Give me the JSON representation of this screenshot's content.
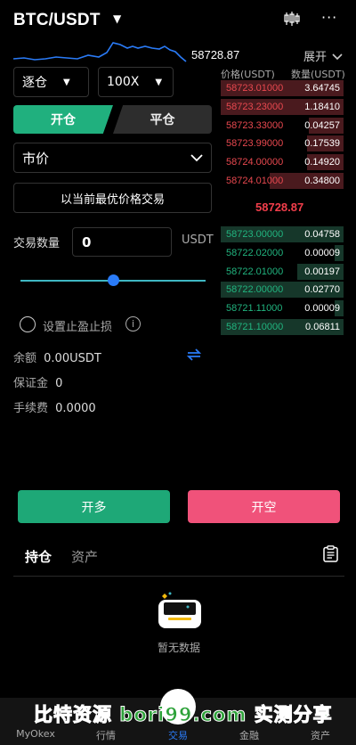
{
  "header": {
    "pair": "BTC/USDT",
    "pair_caret": "▼",
    "chart_icon": "candlestick-chart-icon",
    "more_icon": "more-dots-icon"
  },
  "mini_chart": {
    "price": "58728.87",
    "expand_label": "展开",
    "line_color": "#2a7bf7"
  },
  "margin_mode": {
    "value": "逐仓"
  },
  "leverage": {
    "value": "100X"
  },
  "side_tabs": {
    "open": "开仓",
    "close": "平仓"
  },
  "order_type": {
    "value": "市价"
  },
  "best_price_label": "以当前最优价格交易",
  "quantity": {
    "label": "交易数量",
    "value": "0",
    "unit": "USDT"
  },
  "slider": {
    "level": 0.5
  },
  "tpsl": {
    "label": "设置止盈止损"
  },
  "balance": {
    "label": "余额",
    "value": "0.00USDT"
  },
  "margin": {
    "label": "保证金",
    "value": "0"
  },
  "fee": {
    "label": "手续费",
    "value": "0.0000"
  },
  "buttons": {
    "long": "开多",
    "short": "开空"
  },
  "orderbook": {
    "price_header": "价格(USDT)",
    "qty_header": "数量(USDT)",
    "asks": [
      {
        "price": "58723.01000",
        "qty": "3.64745",
        "depth": 1.0
      },
      {
        "price": "58723.23000",
        "qty": "1.18410",
        "depth": 1.0
      },
      {
        "price": "58723.33000",
        "qty": "0.04257",
        "depth": 0.28
      },
      {
        "price": "58723.99000",
        "qty": "0.17539",
        "depth": 0.3
      },
      {
        "price": "58724.00000",
        "qty": "0.14920",
        "depth": 0.3
      },
      {
        "price": "58724.01000",
        "qty": "0.34800",
        "depth": 0.6
      }
    ],
    "mid_price": "58728.87",
    "bids": [
      {
        "price": "58723.00000",
        "qty": "0.04758",
        "depth": 1.0
      },
      {
        "price": "58722.02000",
        "qty": "0.00009",
        "depth": 0.07
      },
      {
        "price": "58722.01000",
        "qty": "0.00197",
        "depth": 0.38
      },
      {
        "price": "58722.00000",
        "qty": "0.02770",
        "depth": 1.0
      },
      {
        "price": "58721.11000",
        "qty": "0.00009",
        "depth": 0.07
      },
      {
        "price": "58721.10000",
        "qty": "0.06811",
        "depth": 1.0
      }
    ]
  },
  "positions": {
    "tab_holdings": "持仓",
    "tab_assets": "资产",
    "empty_text": "暂无数据"
  },
  "nav": {
    "items": [
      {
        "label": "MyOkex"
      },
      {
        "label": "行情"
      },
      {
        "label": "交易"
      },
      {
        "label": "金融"
      },
      {
        "label": "资产"
      }
    ],
    "active_color": "#2a7bf7"
  },
  "watermark": "比特资源 bori99.com 实测分享"
}
